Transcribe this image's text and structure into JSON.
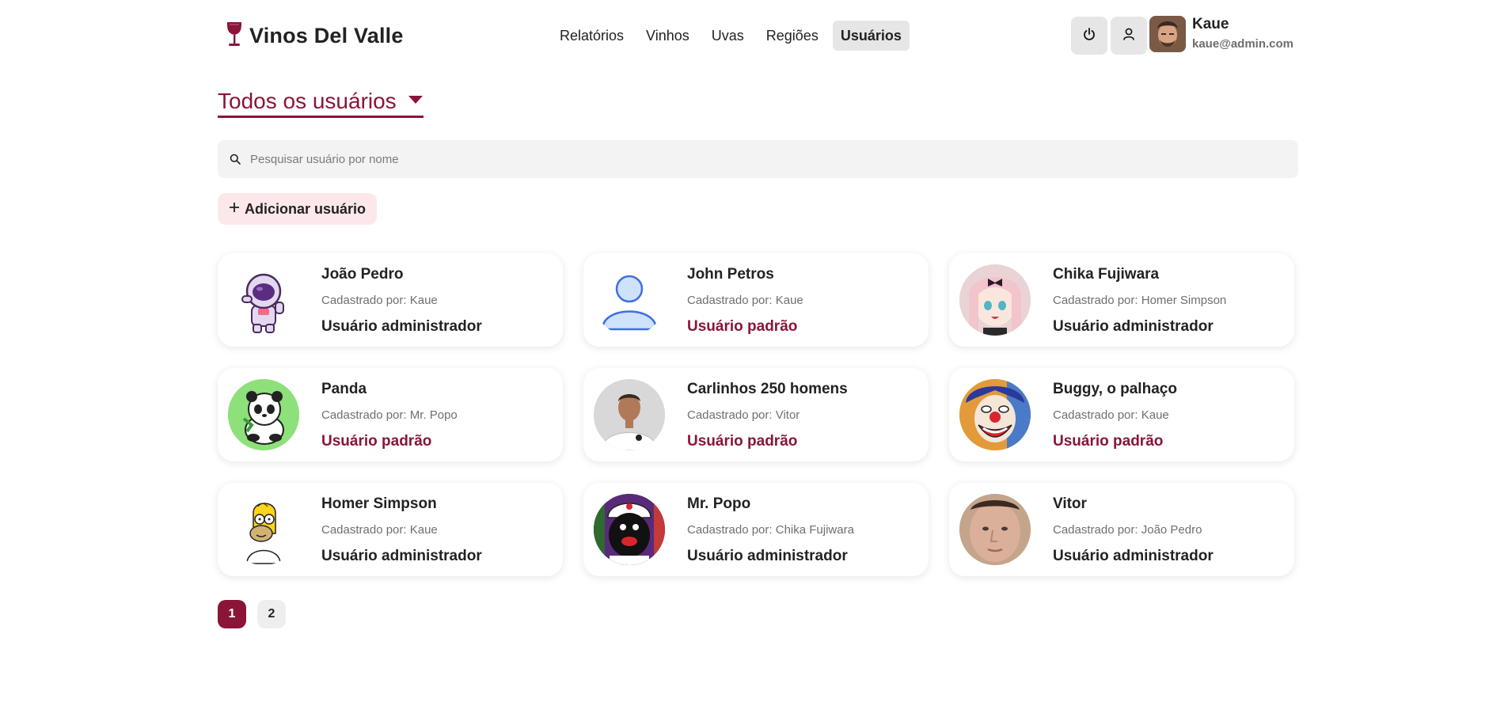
{
  "app": {
    "title": "Vinos Del Valle"
  },
  "nav": {
    "items": [
      "Relatórios",
      "Vinhos",
      "Uvas",
      "Regiões",
      "Usuários"
    ],
    "active_index": 4
  },
  "user": {
    "name": "Kaue",
    "email": "kaue@admin.com"
  },
  "header_icons": [
    "power-icon",
    "user-icon"
  ],
  "page": {
    "filter_label": "Todos os usuários"
  },
  "search": {
    "placeholder": "Pesquisar usuário por nome",
    "value": ""
  },
  "add_button": {
    "label": "Adicionar usuário"
  },
  "cards": [
    {
      "name": "João Pedro",
      "by": "Cadastrado por: Kaue",
      "role": "Usuário administrador",
      "role_type": "admin",
      "avatar": "astronaut"
    },
    {
      "name": "John Petros",
      "by": "Cadastrado por: Kaue",
      "role": "Usuário padrão",
      "role_type": "standard",
      "avatar": "default-user"
    },
    {
      "name": "Chika Fujiwara",
      "by": "Cadastrado por: Homer Simpson",
      "role": "Usuário administrador",
      "role_type": "admin",
      "avatar": "anime-girl"
    },
    {
      "name": "Panda",
      "by": "Cadastrado por: Mr. Popo",
      "role": "Usuário padrão",
      "role_type": "standard",
      "avatar": "panda"
    },
    {
      "name": "Carlinhos 250 homens",
      "by": "Cadastrado por: Vitor",
      "role": "Usuário padrão",
      "role_type": "standard",
      "avatar": "man-photo"
    },
    {
      "name": "Buggy, o palhaço",
      "by": "Cadastrado por: Kaue",
      "role": "Usuário padrão",
      "role_type": "standard",
      "avatar": "clown"
    },
    {
      "name": "Homer Simpson",
      "by": "Cadastrado por: Kaue",
      "role": "Usuário administrador",
      "role_type": "admin",
      "avatar": "homer"
    },
    {
      "name": "Mr. Popo",
      "by": "Cadastrado por: Chika Fujiwara",
      "role": "Usuário administrador",
      "role_type": "admin",
      "avatar": "popo"
    },
    {
      "name": "Vitor",
      "by": "Cadastrado por: João Pedro",
      "role": "Usuário administrador",
      "role_type": "admin",
      "avatar": "face-photo"
    }
  ],
  "pagination": {
    "pages": [
      "1",
      "2"
    ],
    "current": "1"
  },
  "colors": {
    "brand": "#8a1538",
    "add_button_bg": "#fce8ea",
    "nav_active_bg": "#e6e6e6"
  }
}
